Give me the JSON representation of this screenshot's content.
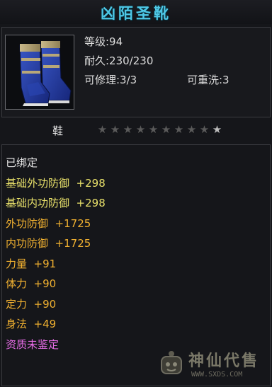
{
  "title": "凶陌圣靴",
  "item": {
    "icon": "blue-boots-icon",
    "level": "等级:94",
    "durability": "耐久:230/230",
    "repairable": "可修理:3/3",
    "rewashable": "可重洗:3"
  },
  "slot": {
    "type": "鞋",
    "stars_total": 10,
    "stars_filled": 0
  },
  "attributes": [
    {
      "text": "已绑定",
      "color": "#e6e6e6"
    },
    {
      "text": "基础外功防御  +298",
      "color": "#e8e06a"
    },
    {
      "text": "基础内功防御  +298",
      "color": "#e8e06a"
    },
    {
      "text": "外功防御  +1725",
      "color": "#f0b030"
    },
    {
      "text": "内功防御  +1725",
      "color": "#f0b030"
    },
    {
      "text": "力量  +91",
      "color": "#f0b030"
    },
    {
      "text": "体力  +90",
      "color": "#f0b030"
    },
    {
      "text": "定力  +90",
      "color": "#f0b030"
    },
    {
      "text": "身法  +49",
      "color": "#f0b030"
    },
    {
      "text": "资质未鉴定",
      "color": "#e66ce6"
    }
  ],
  "watermark": {
    "name": "神仙代售",
    "url": "WWW.SXDS.COM",
    "icon": "mascot-icon"
  },
  "colors": {
    "title": "#4ec8e6",
    "star_empty": "#5a5a5a",
    "star_last": "#bdbdbd"
  }
}
